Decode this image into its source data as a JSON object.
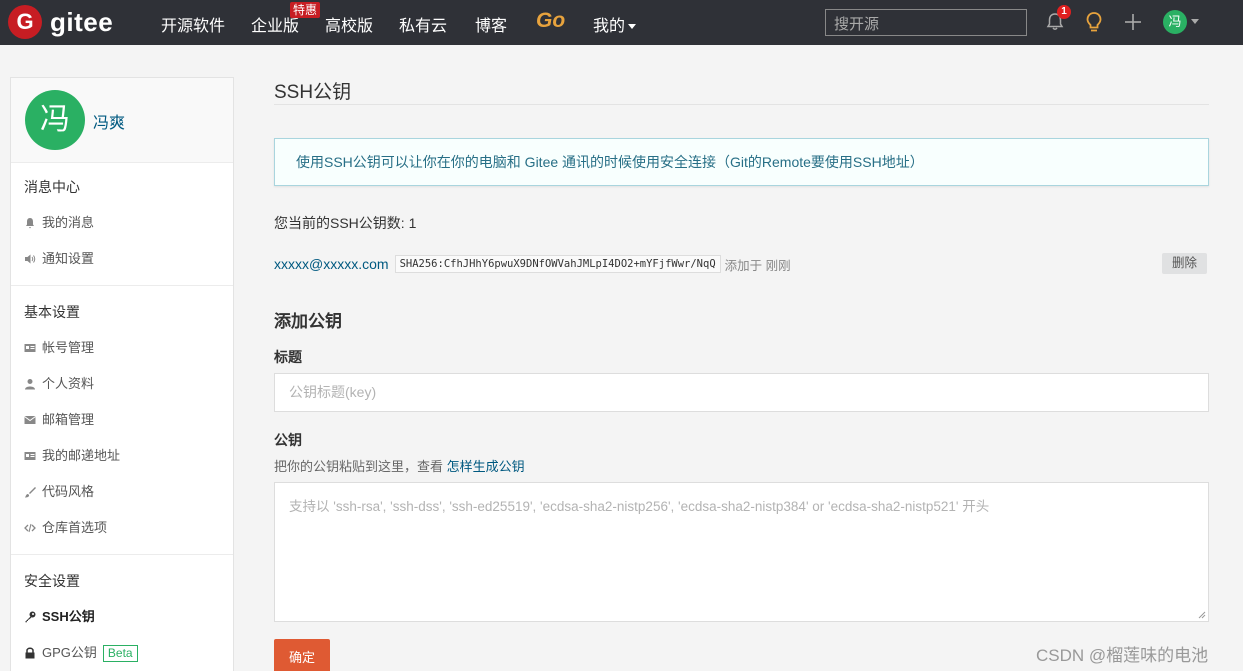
{
  "brand": {
    "logo_letter": "G",
    "name": "gitee"
  },
  "nav": {
    "items": [
      "开源软件",
      "企业版",
      "高校版",
      "私有云",
      "博客"
    ],
    "special_badge": "特惠",
    "go": "Go",
    "mine": "我的",
    "search_placeholder": "搜开源",
    "notification_count": "1",
    "avatar_letter": "冯"
  },
  "sidebar": {
    "avatar_letter": "冯",
    "user_name": "冯爽",
    "sections": [
      {
        "title": "消息中心",
        "items": [
          "我的消息",
          "通知设置"
        ]
      },
      {
        "title": "基本设置",
        "items": [
          "帐号管理",
          "个人资料",
          "邮箱管理",
          "我的邮递地址",
          "代码风格",
          "仓库首选项"
        ]
      },
      {
        "title": "安全设置",
        "items": [
          "SSH公钥",
          "GPG公钥"
        ]
      }
    ],
    "beta_label": "Beta"
  },
  "main": {
    "title": "SSH公钥",
    "info": "使用SSH公钥可以让你在你的电脑和 Gitee 通讯的时候使用安全连接（Git的Remote要使用SSH地址）",
    "key_count_text": "您当前的SSH公钥数: 1",
    "key": {
      "email": "xxxxx@xxxxx.com",
      "fingerprint": "SHA256:CfhJHhY6pwuX9DNfOWVahJMLpI4DO2+mYFjfWwr/NqQ",
      "added": "添加于 刚刚",
      "delete_label": "删除"
    },
    "add_title": "添加公钥",
    "title_label": "标题",
    "title_placeholder": "公钥标题(key)",
    "key_label": "公钥",
    "key_help_prefix": "把你的公钥粘贴到这里，查看 ",
    "key_help_link": "怎样生成公钥",
    "key_placeholder": "支持以 'ssh-rsa', 'ssh-dss', 'ssh-ed25519', 'ecdsa-sha2-nistp256', 'ecdsa-sha2-nistp384' or 'ecdsa-sha2-nistp521' 开头",
    "submit_label": "确定"
  },
  "watermark": "CSDN @榴莲味的电池",
  "colors": {
    "nav_bg": "#2f3137",
    "brand_red": "#c71d23",
    "avatar_green": "#2ab063",
    "submit_orange": "#df5a33",
    "link": "#005980",
    "go_orange": "#e8a33d"
  }
}
